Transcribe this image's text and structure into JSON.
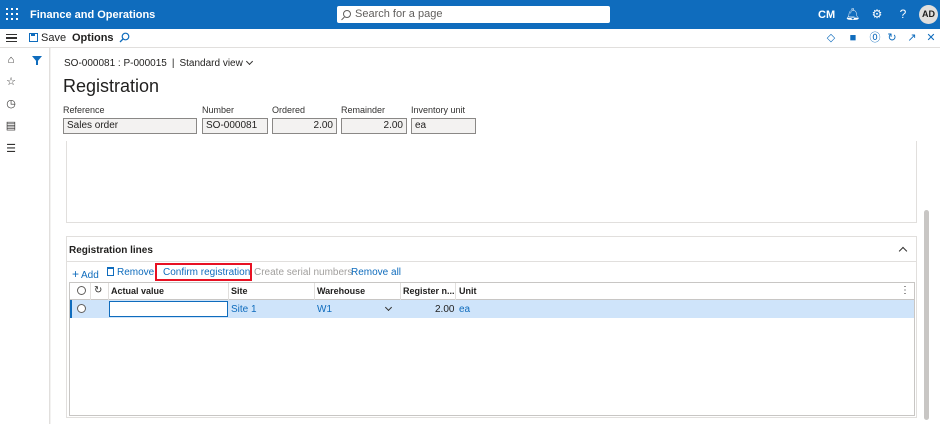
{
  "topbar": {
    "app_title": "Finance and Operations",
    "search_placeholder": "Search for a page",
    "company": "CM",
    "avatar_initials": "AD"
  },
  "actionbar": {
    "save_label": "Save",
    "options_label": "Options"
  },
  "page": {
    "breadcrumb_record": "SO-000081 : P-000015",
    "breadcrumb_separator": "|",
    "view_name": "Standard view",
    "title": "Registration"
  },
  "header_fields": [
    {
      "label": "Reference",
      "value": "Sales order"
    },
    {
      "label": "Number",
      "value": "SO-000081"
    },
    {
      "label": "Ordered",
      "value": "2.00"
    },
    {
      "label": "Remainder",
      "value": "2.00"
    },
    {
      "label": "Inventory unit",
      "value": "ea"
    }
  ],
  "lines": {
    "title": "Registration lines",
    "toolbar": {
      "add": "Add",
      "remove": "Remove",
      "confirm": "Confirm registration",
      "create_serial": "Create serial numbers",
      "remove_all": "Remove all"
    },
    "columns": [
      "Actual value",
      "Site",
      "Warehouse",
      "Register n...",
      "Unit"
    ],
    "rows": [
      {
        "actual_value": "",
        "site": "Site 1",
        "warehouse": "W1",
        "register_now": "2.00",
        "unit": "ea"
      }
    ]
  }
}
